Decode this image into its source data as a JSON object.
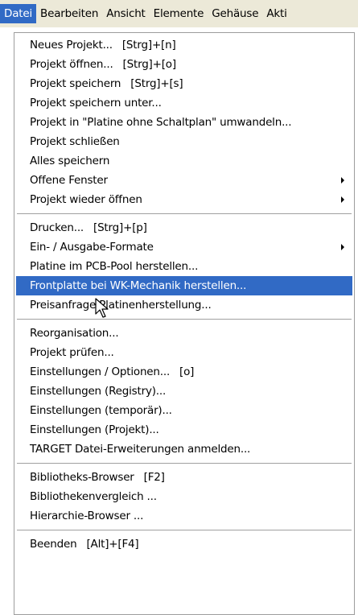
{
  "menubar": {
    "items": [
      "Datei",
      "Bearbeiten",
      "Ansicht",
      "Elemente",
      "Gehäuse",
      "Akti"
    ]
  },
  "menu": {
    "group1": [
      {
        "label": "Neues Projekt...",
        "shortcut": "[Strg]+[n]"
      },
      {
        "label": "Projekt öffnen...",
        "shortcut": "[Strg]+[o]"
      },
      {
        "label": "Projekt speichern",
        "shortcut": "[Strg]+[s]"
      },
      {
        "label": "Projekt speichern unter...",
        "shortcut": ""
      },
      {
        "label": "Projekt in \"Platine ohne Schaltplan\" umwandeln...",
        "shortcut": ""
      },
      {
        "label": "Projekt schließen",
        "shortcut": ""
      },
      {
        "label": "Alles speichern",
        "shortcut": ""
      },
      {
        "label": "Offene Fenster",
        "shortcut": "",
        "submenu": true
      },
      {
        "label": "Projekt wieder öffnen",
        "shortcut": "",
        "submenu": true
      }
    ],
    "group2": [
      {
        "label": "Drucken...",
        "shortcut": "[Strg]+[p]"
      },
      {
        "label": "Ein- / Ausgabe-Formate",
        "shortcut": "",
        "submenu": true
      },
      {
        "label": "Platine im PCB-Pool herstellen...",
        "shortcut": ""
      },
      {
        "label": "Frontplatte bei WK-Mechanik herstellen...",
        "shortcut": "",
        "highlighted": true
      },
      {
        "label": "Preisanfrage Platinenherstellung...",
        "shortcut": ""
      }
    ],
    "group3": [
      {
        "label": "Reorganisation...",
        "shortcut": ""
      },
      {
        "label": "Projekt prüfen...",
        "shortcut": ""
      },
      {
        "label": "Einstellungen / Optionen...",
        "shortcut": "[o]"
      },
      {
        "label": "Einstellungen (Registry)...",
        "shortcut": ""
      },
      {
        "label": "Einstellungen (temporär)...",
        "shortcut": ""
      },
      {
        "label": "Einstellungen (Projekt)...",
        "shortcut": ""
      },
      {
        "label": "TARGET Datei-Erweiterungen anmelden...",
        "shortcut": ""
      }
    ],
    "group4": [
      {
        "label": "Bibliotheks-Browser",
        "shortcut": "[F2]"
      },
      {
        "label": "Bibliothekenvergleich ...",
        "shortcut": ""
      },
      {
        "label": "Hierarchie-Browser ...",
        "shortcut": ""
      }
    ],
    "group5": [
      {
        "label": "Beenden",
        "shortcut": "[Alt]+[F4]"
      }
    ]
  },
  "colors": {
    "highlight": "#316ac5",
    "menubar_bg": "#ece9d8"
  }
}
